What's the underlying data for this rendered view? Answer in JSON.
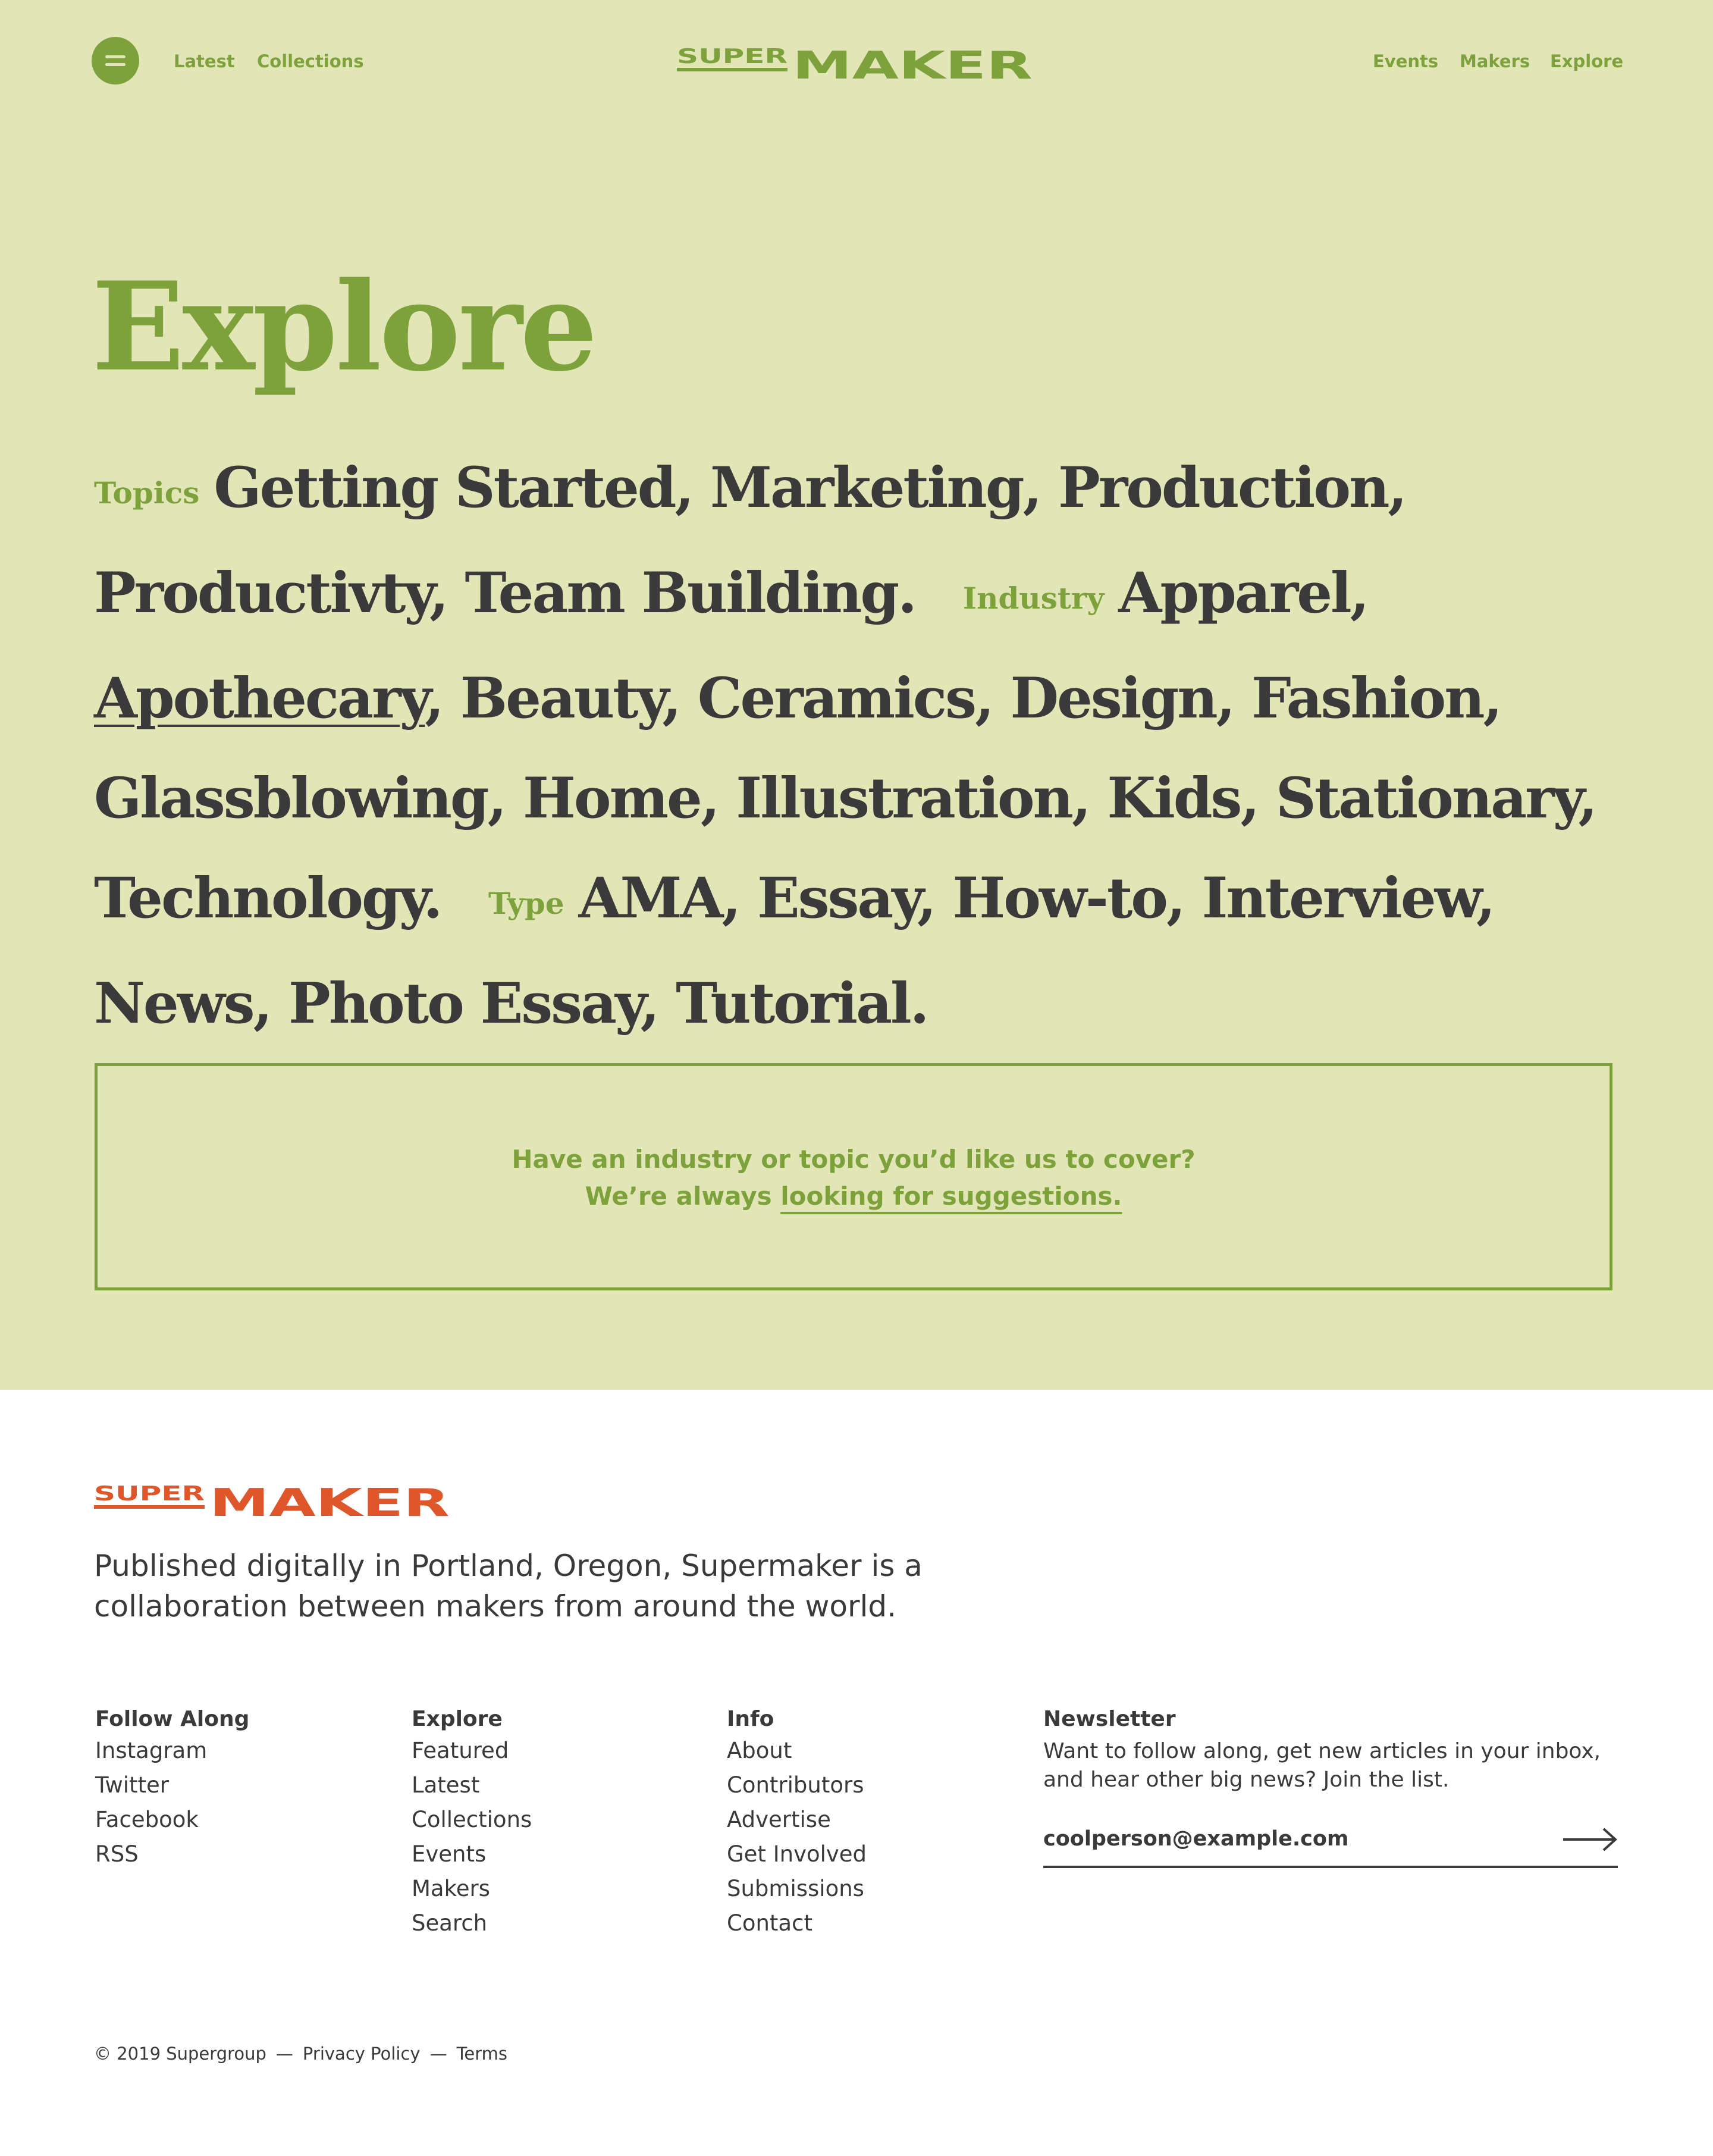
{
  "header": {
    "left_nav": [
      "Latest",
      "Collections"
    ],
    "right_nav": [
      "Events",
      "Makers",
      "Explore"
    ],
    "logo": {
      "word_small": "SUPER",
      "word_large": "MAKER"
    },
    "menu_icon": "hamburger-icon"
  },
  "main": {
    "title": "Explore",
    "groups": [
      {
        "label": "Topics",
        "items": [
          "Getting Started",
          "Marketing",
          "Production",
          "Productivty",
          "Team Building"
        ]
      },
      {
        "label": "Industry",
        "items": [
          "Apparel",
          "Apothecary",
          "Beauty",
          "Ceramics",
          "Design",
          "Fashion",
          "Glassblowing",
          "Home",
          "Illustration",
          "Kids",
          "Stationary",
          "Technology"
        ]
      },
      {
        "label": "Type",
        "items": [
          "AMA",
          "Essay",
          "How-to",
          "Interview",
          "News",
          "Photo Essay",
          "Tutorial"
        ]
      }
    ],
    "suggestion": {
      "line1": "Have an industry or topic you’d like us to cover?",
      "line2_prefix": "We’re always",
      "link": "looking for suggestions."
    }
  },
  "footer": {
    "logo": {
      "word_small": "SUPER",
      "word_large": "MAKER"
    },
    "tagline": "Published digitally in Portland, Oregon, Supermaker is a collaboration between makers from around the world.",
    "columns": [
      {
        "heading": "Follow Along",
        "links": [
          "Instagram",
          "Twitter",
          "Facebook",
          "RSS"
        ]
      },
      {
        "heading": "Explore",
        "links": [
          "Featured",
          "Latest",
          "Collections",
          "Events",
          "Makers",
          "Search"
        ]
      },
      {
        "heading": "Info",
        "links": [
          "About",
          "Contributors",
          "Advertise",
          "Get Involved",
          "Submissions",
          "Contact"
        ]
      }
    ],
    "newsletter": {
      "heading": "Newsletter",
      "description": "Want to follow along, get new articles in your inbox, and hear other big news? Join the list.",
      "email_value": "coolperson@example.com",
      "submit_icon": "arrow-right-icon"
    },
    "legal": {
      "copyright": "© 2019 Supergroup",
      "privacy": "Privacy Policy",
      "terms": "Terms",
      "separator": "—"
    }
  },
  "colors": {
    "background_top": "#e2e6b7",
    "accent_green": "#7da13b",
    "logo_orange": "#e0562b",
    "text_dark": "#3a3a3a"
  }
}
